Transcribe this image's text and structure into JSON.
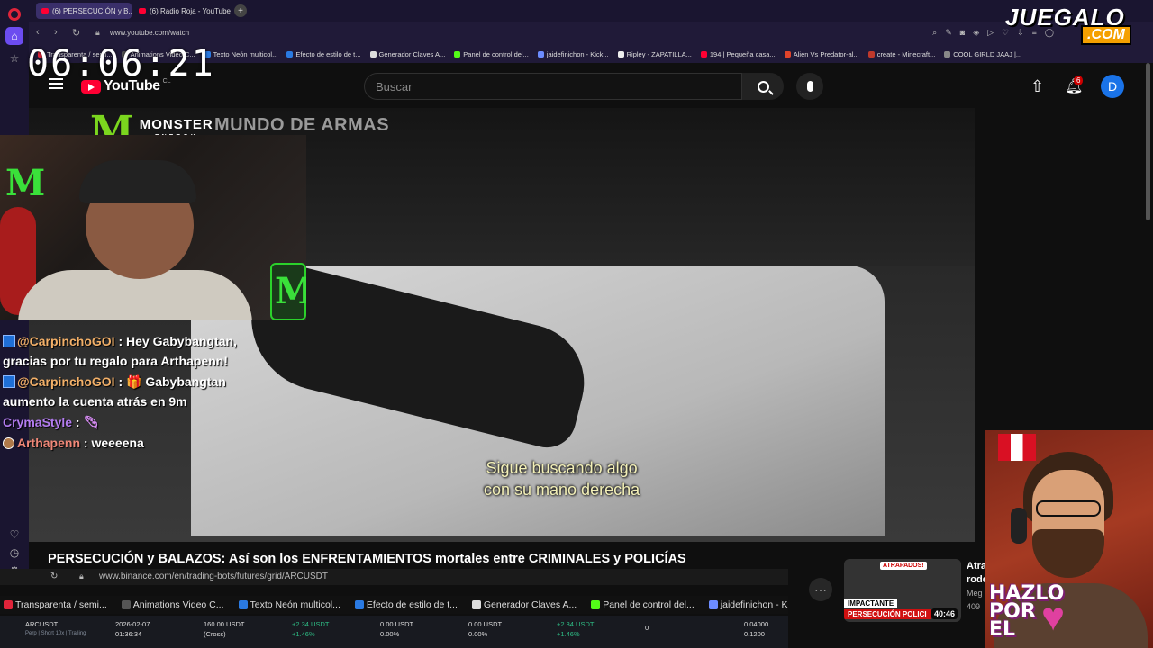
{
  "browser": {
    "tabs": [
      {
        "label": "(6) PERSECUCIÓN y B...",
        "active": true
      },
      {
        "label": "(6) Radio Roja - YouTube",
        "active": false
      }
    ],
    "url": "www.youtube.com/watch",
    "bookmarks": [
      "Transparenta / semi...",
      "Animations Video C...",
      "Texto Neón multicol...",
      "Efecto de estilo de t...",
      "Generador Claves A...",
      "Panel de control del...",
      "jaidefinichon - Kick...",
      "Ripley - ZAPATILLA...",
      "194 | Pequeña casa...",
      "Alien Vs Predator-al...",
      "create - Minecraft...",
      "COOL GIRLD JAAJ |..."
    ]
  },
  "overlay": {
    "logo_main": "JUEGALO",
    "logo_sub": ".COM",
    "clock": "06:06:21",
    "hazlo": [
      "HAZLO",
      "POR",
      "EL"
    ]
  },
  "youtube": {
    "country": "CL",
    "logo_text": "YouTube",
    "search_placeholder": "Buscar",
    "notifications": "6",
    "avatar_letter": "D",
    "video_title": "PERSECUCIÓN y BALAZOS: Así son los ENFRENTAMIENTOS mortales entre CRIMINALES y POLICÍAS",
    "subtitle_line1": "Sigue buscando algo",
    "subtitle_line2": "con su mano derecha",
    "sponsor": "MONSTER",
    "sponsor_sub": "ENERGY",
    "channel_overlay": "MUNDO DE ARMAS"
  },
  "chat": [
    {
      "user": "@CarpinchoGOI",
      "text": " : Hey Gabybangtan, gracias por tu regalo para Arthapenn!"
    },
    {
      "user": "@CarpinchoGOI",
      "text": " : 🎁 Gabybangtan aumento la cuenta atrás en 9m"
    },
    {
      "user": "CrymaStyle",
      "text": " : "
    },
    {
      "user": "Arthapenn",
      "text": " : weeeena"
    }
  ],
  "suggested": {
    "badge": "ATRAPADOS!",
    "tag1": "IMPACTANTE",
    "tag2": "PERSECUCIÓN POLICI",
    "duration": "40:46",
    "title_partial": "Atra",
    "title_partial2": "rode",
    "meta1": "Meg",
    "meta2": "409"
  },
  "binance": {
    "url": "www.binance.com/en/trading-bots/futures/grid/ARCUSDT",
    "bookmarks": [
      "Transparenta / semi...",
      "Animations Video C...",
      "Texto Neón multicol...",
      "Efecto de estilo de t...",
      "Generador Claves A...",
      "Panel de control del...",
      "jaidefinichon - Kick..."
    ],
    "symbol": "ARCUSDT",
    "symbol_sub": "Perp | Short 10x | Trailing",
    "date": "2026-02-07",
    "time": "01:36:34",
    "investment": "160.00 USDT",
    "investment_sub": "(Cross)",
    "pnl1": "+2.34 USDT",
    "pnl1_pct": "+1.46%",
    "pnl2": "0.00 USDT",
    "pnl2_pct": "0.00%",
    "pnl3": "0.00 USDT",
    "pnl3_pct": "0.00%",
    "pnl4": "+2.34 USDT",
    "pnl4_pct": "+1.46%",
    "count": "0",
    "price_a": "0.04000",
    "price_b": "0.1200"
  }
}
